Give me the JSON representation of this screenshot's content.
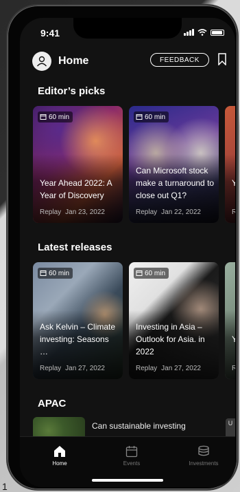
{
  "status_bar": {
    "time": "9:41"
  },
  "header": {
    "title": "Home",
    "feedback_label": "FEEDBACK"
  },
  "sections": {
    "editors_picks": {
      "title": "Editor’s picks",
      "cards": [
        {
          "duration": "60 min",
          "title": "Year Ahead 2022: A Year of Discovery",
          "type": "Replay",
          "date": "Jan 23, 2022"
        },
        {
          "duration": "60 min",
          "title": "Can Microsoft stock make a turnaround to close out Q1?",
          "type": "Replay",
          "date": "Jan 22, 2022"
        },
        {
          "title": "Y",
          "type": "Re"
        }
      ]
    },
    "latest_releases": {
      "title": "Latest releases",
      "cards": [
        {
          "duration": "60 min",
          "title": "Ask Kelvin – Climate investing: Seasons …",
          "type": "Replay",
          "date": "Jan 27, 2022"
        },
        {
          "duration": "60 min",
          "title": "Investing in Asia – Outlook for Asia. in 2022",
          "type": "Replay",
          "date": "Jan 27, 2022"
        },
        {
          "title": "Y",
          "type": "Re"
        }
      ]
    },
    "apac": {
      "title": "APAC",
      "item_title": "Can sustainable investing",
      "side_label": "U"
    }
  },
  "tabbar": {
    "tabs": [
      {
        "label": "Home",
        "icon": "home-icon",
        "active": true
      },
      {
        "label": "Events",
        "icon": "calendar-icon",
        "active": false
      },
      {
        "label": "Investments",
        "icon": "coins-stack-icon",
        "active": false
      }
    ]
  },
  "background_marker": "1",
  "colors": {
    "background": "#121212",
    "text": "#ffffff",
    "muted": "#bbbbbb",
    "tab_inactive": "#777777"
  }
}
